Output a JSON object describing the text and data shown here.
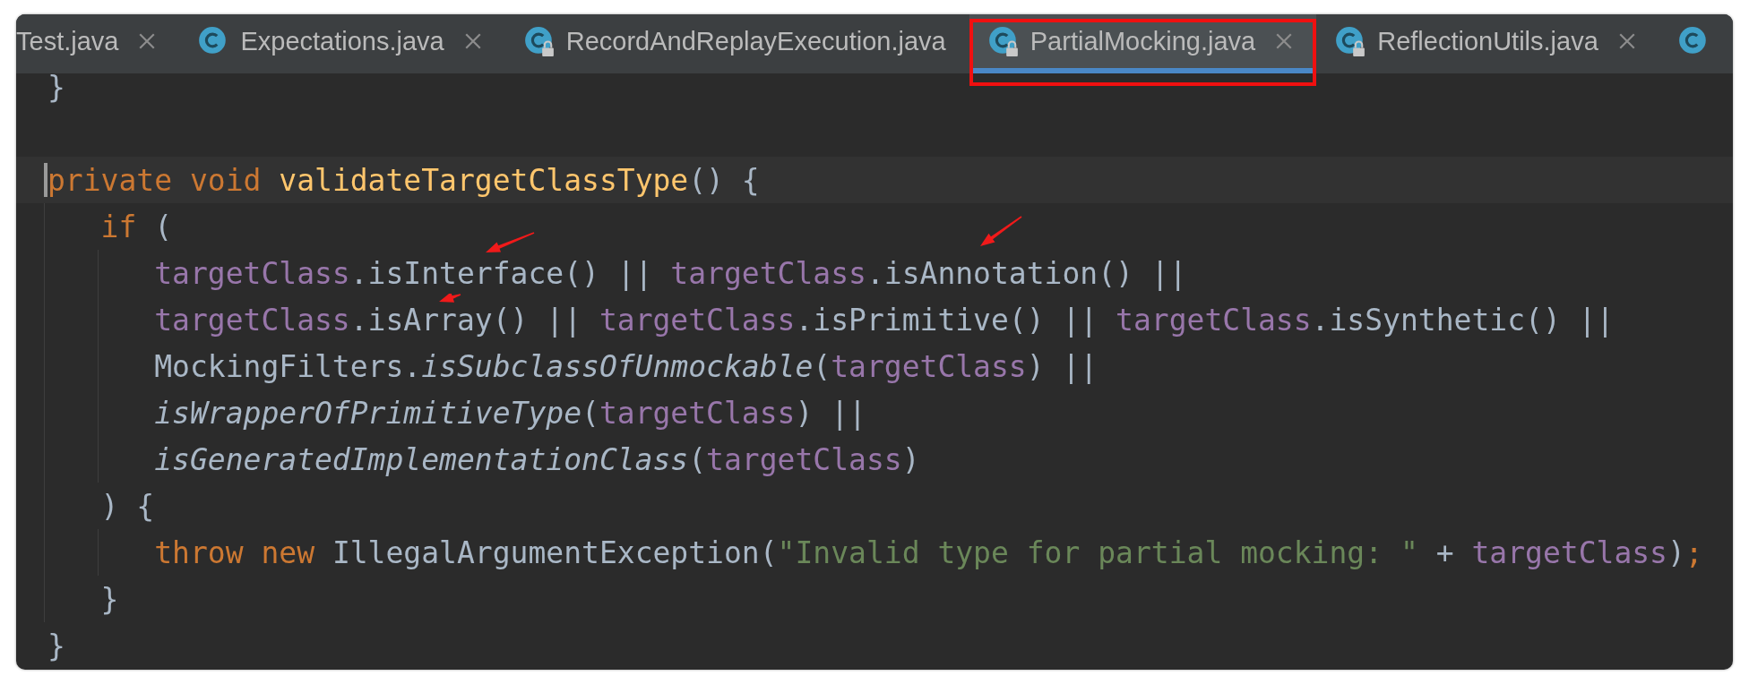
{
  "tabs": [
    {
      "label": "Test.java",
      "selected": false,
      "highlighted": false,
      "closable": true
    },
    {
      "label": "Expectations.java",
      "locked": false,
      "selected": false,
      "highlighted": false,
      "closable": true
    },
    {
      "label": "RecordAndReplayExecution.java",
      "locked": true,
      "selected": false,
      "highlighted": false,
      "closable": false
    },
    {
      "label": "PartialMocking.java",
      "locked": true,
      "selected": true,
      "highlighted": true,
      "closable": true
    },
    {
      "label": "ReflectionUtils.java",
      "locked": true,
      "selected": false,
      "highlighted": false,
      "closable": true
    },
    {
      "locked": false,
      "selected": false,
      "highlighted": false,
      "closable": false
    }
  ],
  "code_lines": [
    {
      "current": false,
      "tokens": [
        {
          "kind": "plain",
          "text": "}"
        }
      ]
    },
    {
      "current": false
    },
    {
      "current": true,
      "tokens": [
        {
          "kind": "keyword",
          "text": "private void "
        },
        {
          "kind": "declaration",
          "text": "validateTargetClassType"
        },
        {
          "kind": "plain",
          "text": "() {"
        }
      ],
      "children": [
        {
          "current": false,
          "tokens": [
            {
              "kind": "keyword",
              "text": "if "
            },
            {
              "kind": "plain",
              "text": "("
            }
          ],
          "children": [
            {
              "current": false,
              "tokens": [
                {
                  "kind": "field",
                  "text": "targetClass"
                },
                {
                  "kind": "plain",
                  "text": ".isInterface() || "
                },
                {
                  "kind": "field",
                  "text": "targetClass"
                },
                {
                  "kind": "plain",
                  "text": ".isAnnotation() ||"
                }
              ]
            },
            {
              "current": false,
              "tokens": [
                {
                  "kind": "field",
                  "text": "targetClass"
                },
                {
                  "kind": "plain",
                  "text": ".isArray() || "
                },
                {
                  "kind": "field",
                  "text": "targetClass"
                },
                {
                  "kind": "plain",
                  "text": ".isPrimitive() || "
                },
                {
                  "kind": "field",
                  "text": "targetClass"
                },
                {
                  "kind": "plain",
                  "text": ".isSynthetic() ||"
                }
              ]
            },
            {
              "current": false,
              "tokens": [
                {
                  "kind": "plain",
                  "text": "MockingFilters."
                },
                {
                  "kind": "static",
                  "text": "isSubclassOfUnmockable"
                },
                {
                  "kind": "plain",
                  "text": "("
                },
                {
                  "kind": "field",
                  "text": "targetClass"
                },
                {
                  "kind": "plain",
                  "text": ") ||"
                }
              ]
            },
            {
              "current": false,
              "tokens": [
                {
                  "kind": "static",
                  "text": "isWrapperOfPrimitiveType"
                },
                {
                  "kind": "plain",
                  "text": "("
                },
                {
                  "kind": "field",
                  "text": "targetClass"
                },
                {
                  "kind": "plain",
                  "text": ") ||"
                }
              ]
            },
            {
              "current": false,
              "tokens": [
                {
                  "kind": "static",
                  "text": "isGeneratedImplementationClass"
                },
                {
                  "kind": "plain",
                  "text": "("
                },
                {
                  "kind": "field",
                  "text": "targetClass"
                },
                {
                  "kind": "plain",
                  "text": ")"
                }
              ]
            }
          ]
        },
        {
          "current": false,
          "tokens": [
            {
              "kind": "plain",
              "text": ") {"
            }
          ],
          "children": [
            {
              "current": false,
              "tokens": [
                {
                  "kind": "keyword",
                  "text": "throw new "
                },
                {
                  "kind": "plain",
                  "text": "IllegalArgumentException("
                },
                {
                  "kind": "string",
                  "text": "\"Invalid type for partial mocking: \""
                },
                {
                  "kind": "plain",
                  "text": " + "
                },
                {
                  "kind": "field",
                  "text": "targetClass"
                },
                {
                  "kind": "plain",
                  "text": ")"
                },
                {
                  "kind": "keyword",
                  "text": ";"
                }
              ]
            }
          ]
        },
        {
          "current": false,
          "tokens": [
            {
              "kind": "plain",
              "text": "}"
            }
          ]
        }
      ]
    },
    {
      "current": false,
      "tokens": [
        {
          "kind": "plain",
          "text": "}"
        }
      ]
    }
  ]
}
